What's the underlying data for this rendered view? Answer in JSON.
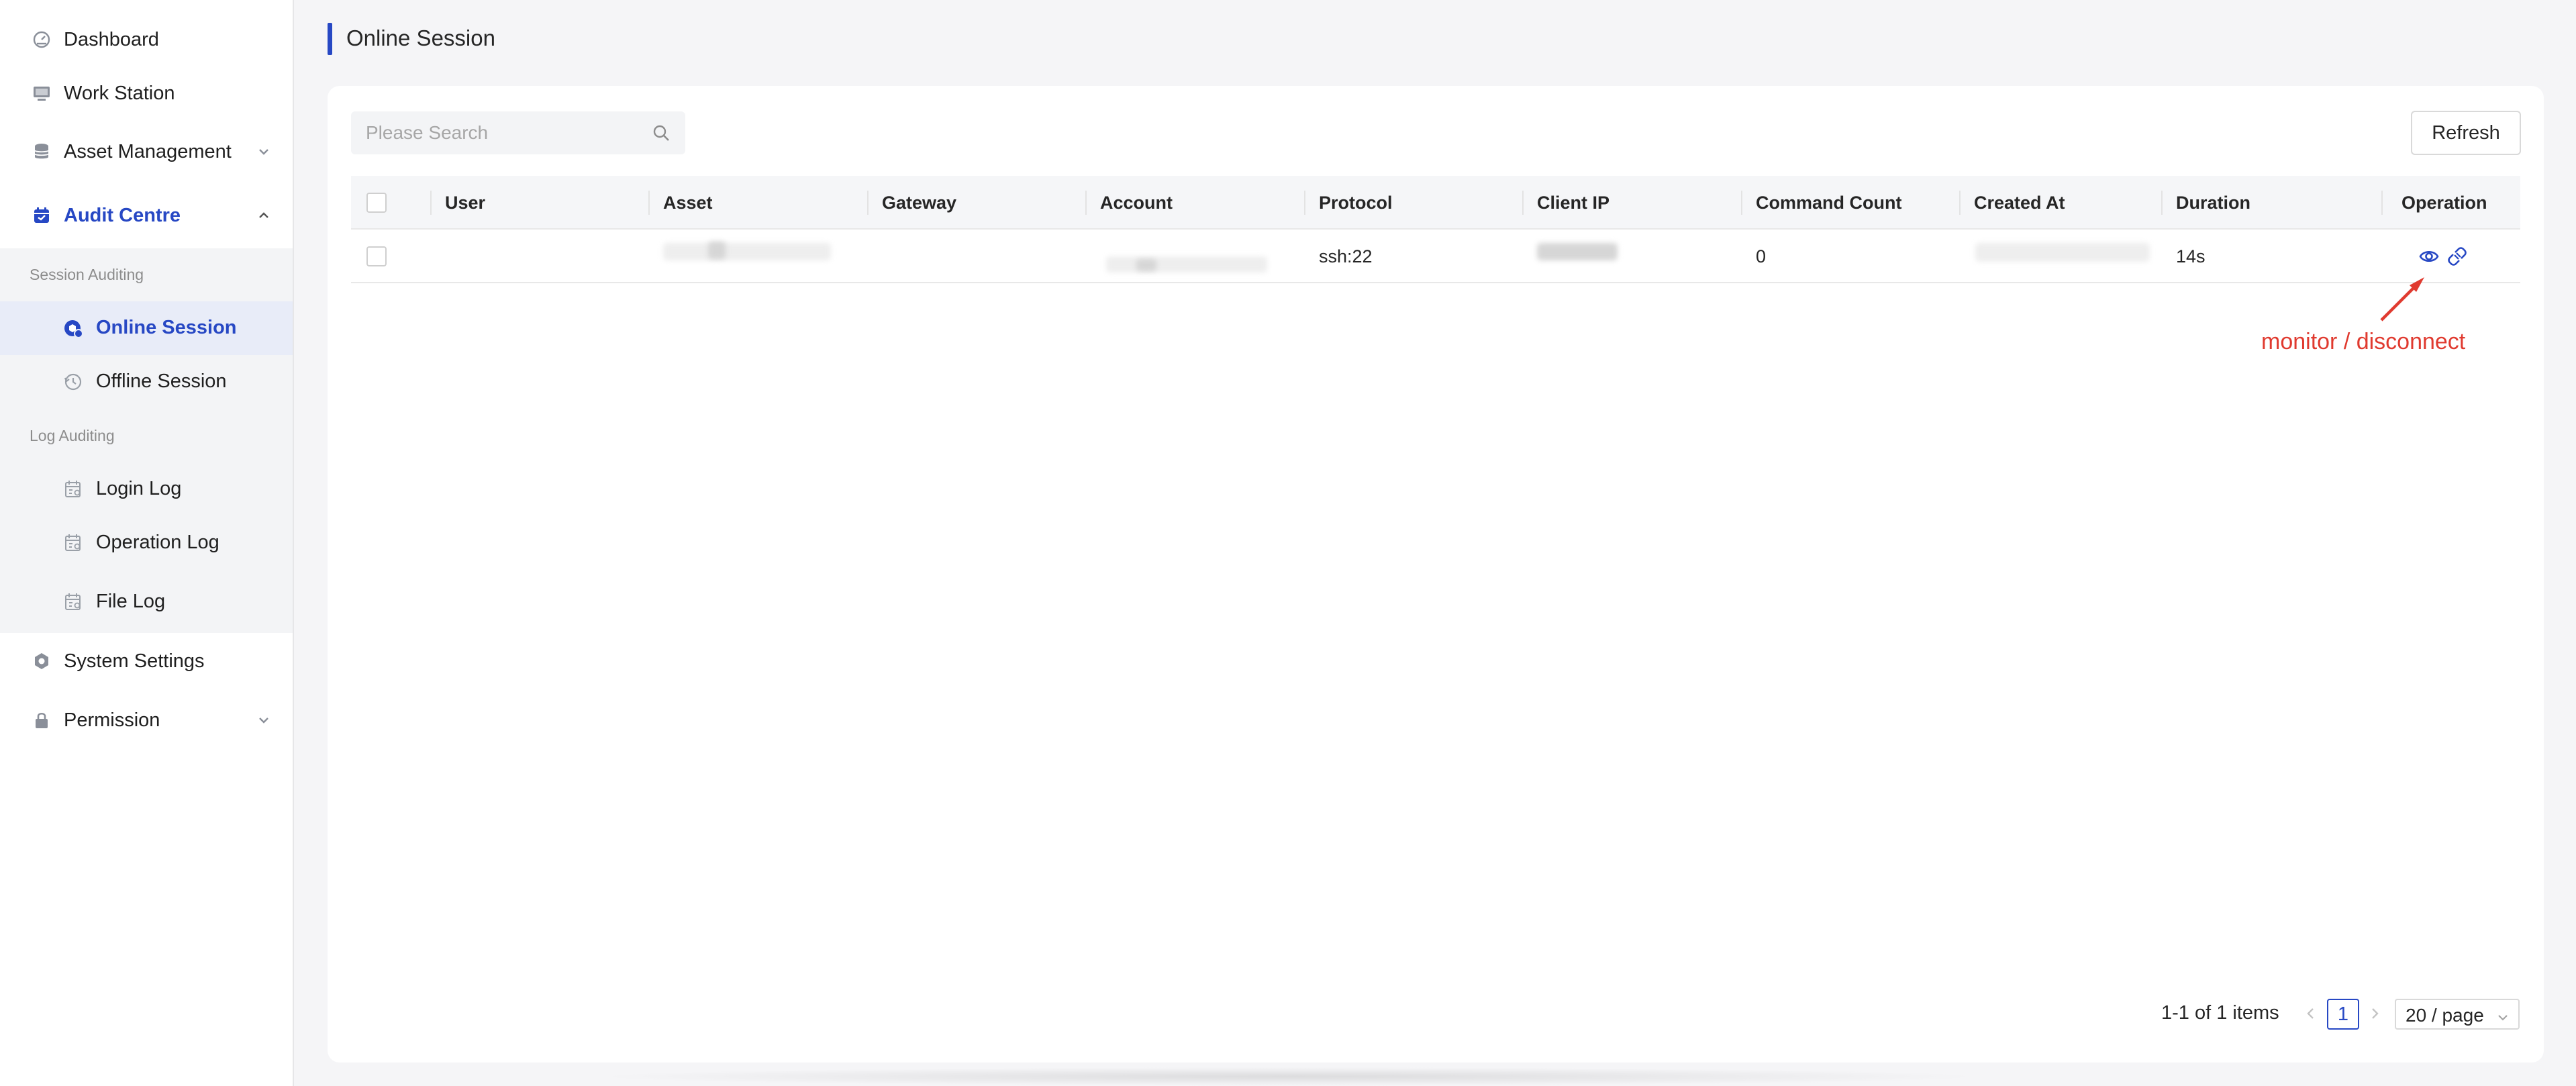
{
  "sidebar": {
    "items": [
      {
        "label": "Dashboard",
        "icon": "dashboard-icon"
      },
      {
        "label": "Work Station",
        "icon": "monitor-icon"
      },
      {
        "label": "Asset Management",
        "icon": "database-icon"
      },
      {
        "label": "Audit Centre",
        "icon": "calendar-check-icon"
      },
      {
        "label": "System Settings",
        "icon": "gear-icon"
      },
      {
        "label": "Permission",
        "icon": "lock-icon"
      }
    ],
    "groups": [
      {
        "label": "Session Auditing",
        "items": [
          {
            "label": "Online Session",
            "icon": "session-online-icon"
          },
          {
            "label": "Offline Session",
            "icon": "history-icon"
          }
        ]
      },
      {
        "label": "Log Auditing",
        "items": [
          {
            "label": "Login Log",
            "icon": "log-calendar-icon"
          },
          {
            "label": "Operation Log",
            "icon": "log-calendar-icon"
          },
          {
            "label": "File Log",
            "icon": "log-calendar-icon"
          }
        ]
      }
    ]
  },
  "page": {
    "title": "Online Session"
  },
  "toolbar": {
    "search_placeholder": "Please Search",
    "refresh_label": "Refresh"
  },
  "table": {
    "columns": [
      "User",
      "Asset",
      "Gateway",
      "Account",
      "Protocol",
      "Client IP",
      "Command Count",
      "Created At",
      "Duration",
      "Operation"
    ],
    "rows": [
      {
        "user": "",
        "asset": "",
        "gateway": "",
        "account": "",
        "protocol": "ssh:22",
        "client_ip": "",
        "command_count": "0",
        "created_at": "",
        "duration": "14s",
        "operations": [
          "monitor-icon",
          "disconnect-icon"
        ]
      }
    ]
  },
  "annotation": {
    "text": "monitor / disconnect",
    "color": "#e03a2f"
  },
  "pagination": {
    "total_text": "1-1 of 1 items",
    "current_page": "1",
    "page_size": "20 / page"
  },
  "colors": {
    "accent": "#2748c4",
    "annotation": "#e03a2f"
  }
}
